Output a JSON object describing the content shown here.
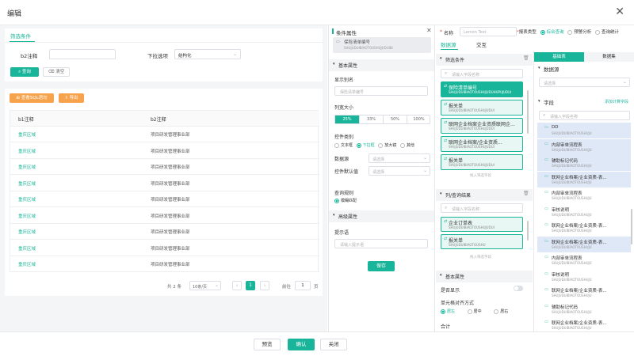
{
  "header": {
    "title": "编辑",
    "close": "✕"
  },
  "filter": {
    "tab": "筛选条件",
    "b2_label": "b2注释",
    "dropdown_label": "下拉选项",
    "dropdown_value": "结构化",
    "search_btn": "查询",
    "clear_btn": "清空"
  },
  "table": {
    "btn_sql": "查看SQL语句",
    "btn_export": "导出",
    "col1": "b1注释",
    "col2": "b2注释",
    "rows": [
      [
        "重庆区域",
        "项目研发管理事业部"
      ],
      [
        "重庆区域",
        "项目研发管理事业部"
      ],
      [
        "重庆区域",
        "项目研发管理事业部"
      ],
      [
        "重庆区域",
        "项目研发管理事业部"
      ],
      [
        "重庆区域",
        "项目研发管理事业部"
      ],
      [
        "重庆区域",
        "项目研发管理事业部"
      ],
      [
        "重庆区域",
        "项目研发管理事业部"
      ],
      [
        "重庆区域",
        "项目研发管理事业部"
      ],
      [
        "重庆区域",
        "项目研发管理事业部"
      ]
    ]
  },
  "pagination": {
    "total": "共 2 条",
    "page_size": "10条/页",
    "prev": "‹",
    "page": "1",
    "next": "›",
    "goto": "前往",
    "goto_val": "1",
    "unit": "页"
  },
  "cond": {
    "title": "条件属性",
    "field_name": "保险清单编号",
    "field_sub": "SHUJUDUIBIAOTOUSHUJUDUIBI",
    "basic": "基本属性",
    "alias_label": "显示别名",
    "alias_ph": "保险清单编号",
    "width_label": "列宽大小",
    "widths": [
      "25%",
      "33%",
      "50%",
      "100%"
    ],
    "ctrl_label": "控件类别",
    "ctrl_opts": [
      "文本框",
      "下拉框",
      "放大镜",
      "其他"
    ],
    "ds_label": "数据源",
    "ds_ph": "请选择",
    "def_label": "控件默认值",
    "def_ph": "请选择",
    "rule_label": "查询规则",
    "rule_opt": "模糊匹配",
    "adv": "高级属性",
    "tip_label": "提示语",
    "tip_ph": "请输入提示语",
    "save": "保存"
  },
  "mid": {
    "name_label": "名称",
    "name_val": "Lemon Test",
    "type_label": "报表类型",
    "type_opts": [
      "综合查询",
      "预警分析",
      "查询统计"
    ],
    "tab_ds": "数据源",
    "tab_inter": "交互",
    "filter_title": "筛选条件",
    "search_ph": "请输入字段名称",
    "filter_fields": [
      {
        "n": "保险清单编号",
        "s": "SHUJUDUIBIAOTOUSHUJUDUHUPUJUDUI"
      },
      {
        "n": "报关单",
        "s": "SHUJUDUIBIAOTOUSHUJUDUI"
      },
      {
        "n": "联网企业档案企业资质联网企...",
        "s": "SHUJUDUIBIAOTOUSHUJUDUI"
      },
      {
        "n": "联网企业档案/企业资质...",
        "s": "SHUJUDUIBIAOTOUSHUJUDUI"
      },
      {
        "n": "报关单",
        "s": "SHUJUDUIBIAOTOUSHUJUDUI"
      }
    ],
    "drop_hint": "拖入筛选字段",
    "col_title": "列/查询结果",
    "col_fields": [
      {
        "n": "企业订单表",
        "s": "SHUJUDUIBIAOTOUSHUJUDUI"
      },
      {
        "n": "报关单",
        "s": "SHUJUDUIBIAOTOUSHU"
      }
    ],
    "drop_hint2": "拖入筛选字段",
    "basic": "基本属性",
    "show_label": "是否显示",
    "align_label": "单元格对齐方式",
    "align_opts": [
      "居左",
      "居中",
      "居右"
    ],
    "total_label": "合计"
  },
  "right": {
    "tabs": [
      "基础表",
      "数据集"
    ],
    "ds_title": "数据源",
    "ds_ph": "请选择",
    "field_title": "字段",
    "add_calc": "添加计算字段",
    "search_ph": "请输入字段名称",
    "fields": [
      {
        "n": "DD",
        "s": "SHUJUDUIBIAOTOUSHUJU",
        "hl": true
      },
      {
        "n": "内部审单流程表",
        "s": "SHUJUDUIBIAOTOUSHUJU",
        "hl": true
      },
      {
        "n": "辅助标记代码",
        "s": "SHUJUDUIBIAOTOUSHUJU",
        "hl": true
      },
      {
        "n": "联网企业档案/企业资质-表...",
        "s": "SHUJUDUIBIAOTOUSHUJU",
        "hl": true
      },
      {
        "n": "内部审单流程表",
        "s": "SHUJUDUIBIAOTOUSHUJU",
        "hl": false
      },
      {
        "n": "审核说明",
        "s": "SHUJUDUIBIAOTOUSHUJU",
        "hl": false
      },
      {
        "n": "联网企业档案/企业资质-表...",
        "s": "SHUJUDUIBIAOTOUSHUJU",
        "hl": false
      },
      {
        "n": "联网企业档案/企业资质-表...",
        "s": "SHUJUDUIBIAOTOUSHUJU",
        "hl": true
      },
      {
        "n": "内部审单流程表",
        "s": "SHUJUDUIBIAOTOUSHUJU",
        "hl": false
      },
      {
        "n": "审核说明",
        "s": "SHUJUDUIBIAOTOUSHUJU",
        "hl": false
      },
      {
        "n": "联网企业档案/企业资质-表...",
        "s": "SHUJUDUIBIAOTOUSHUJU",
        "hl": false
      },
      {
        "n": "辅助标记代码",
        "s": "SHUJUDUIBIAOTOUSHUJU",
        "hl": false
      },
      {
        "n": "联网企业档案/企业资质-表...",
        "s": "SHUJUDUIBIAOTOUSHUJU",
        "hl": false
      }
    ]
  },
  "footer": {
    "preview": "预览",
    "confirm": "确认",
    "close": "关闭"
  },
  "colors": {
    "accent": "#19b59a",
    "orange": "#f7a24c",
    "link": "#19b59a"
  }
}
